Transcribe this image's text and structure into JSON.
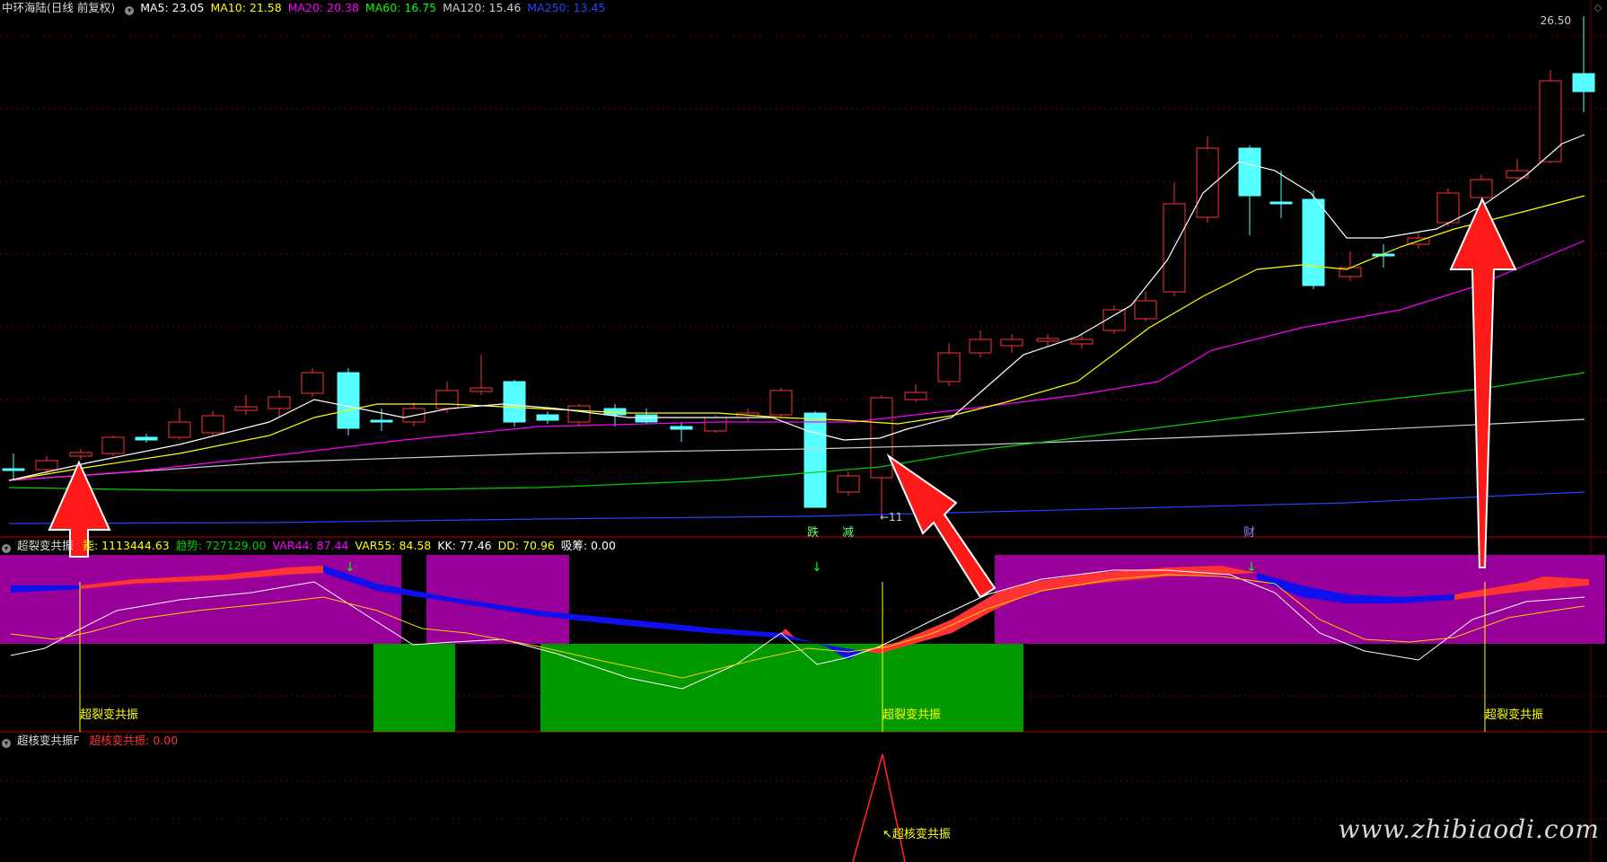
{
  "panel1": {
    "title": "中环海陆(日线 前复权)",
    "indicators": [
      {
        "label": "MA5: 23.05",
        "color": "#ffffff"
      },
      {
        "label": "MA10: 21.58",
        "color": "#ffff00"
      },
      {
        "label": "MA20: 20.38",
        "color": "#ff00ff"
      },
      {
        "label": "MA60: 16.75",
        "color": "#00ff00"
      },
      {
        "label": "MA120: 15.46",
        "color": "#cccccc"
      },
      {
        "label": "MA250: 13.45",
        "color": "#2244ff"
      }
    ],
    "high_label": "26.50",
    "low_label": "←11",
    "markers": [
      "跌",
      "减",
      "财"
    ]
  },
  "panel2": {
    "title": "超裂变共振",
    "indicators": [
      {
        "label": "能: 1113444.63",
        "color": "#ffff00"
      },
      {
        "label": "趋势: 727129.00",
        "color": "#00cc00"
      },
      {
        "label": "VAR44: 87.44",
        "color": "#ff00ff"
      },
      {
        "label": "VAR55: 84.58",
        "color": "#ffff00"
      },
      {
        "label": "KK: 77.46",
        "color": "#ffffff"
      },
      {
        "label": "DD: 70.96",
        "color": "#ffff00"
      },
      {
        "label": "吸筹: 0.00",
        "color": "#ffffff"
      }
    ],
    "signal_label": "超裂变共振"
  },
  "panel3": {
    "title": "超核变共振F",
    "indicators": [
      {
        "label": "超核变共振: 0.00",
        "color": "#ff3333"
      }
    ],
    "signal_label": "超核变共振"
  },
  "watermark": "www.zhibiaodi.com"
}
